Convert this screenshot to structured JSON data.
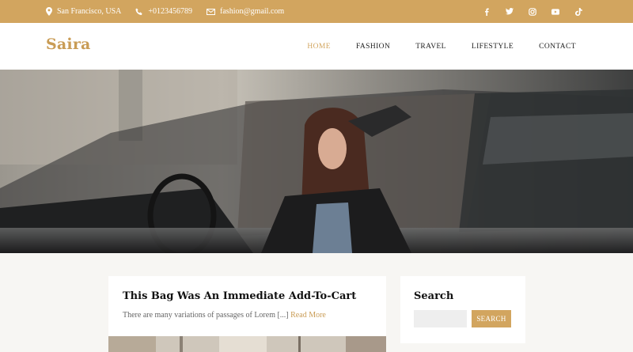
{
  "topbar": {
    "location": "San Francisco, USA",
    "phone": "+0123456789",
    "email": "fashion@gmail.com",
    "social": [
      "facebook-icon",
      "twitter-icon",
      "instagram-icon",
      "youtube-icon",
      "tiktok-icon"
    ],
    "background": "#d2a55f"
  },
  "header": {
    "logo": "Saira",
    "nav": [
      {
        "label": "HOME",
        "active": true
      },
      {
        "label": "FASHION",
        "active": false
      },
      {
        "label": "TRAVEL",
        "active": false
      },
      {
        "label": "LIFESTYLE",
        "active": false
      },
      {
        "label": "CONTACT",
        "active": false
      }
    ],
    "accent": "#c99c55"
  },
  "post": {
    "title": "This Bag Was An Immediate Add-To-Cart",
    "excerpt": "There are many variations of passages of Lorem [...]",
    "read_more": "Read More"
  },
  "sidebar": {
    "search_title": "Search",
    "search_button": "SEARCH",
    "search_placeholder": ""
  }
}
